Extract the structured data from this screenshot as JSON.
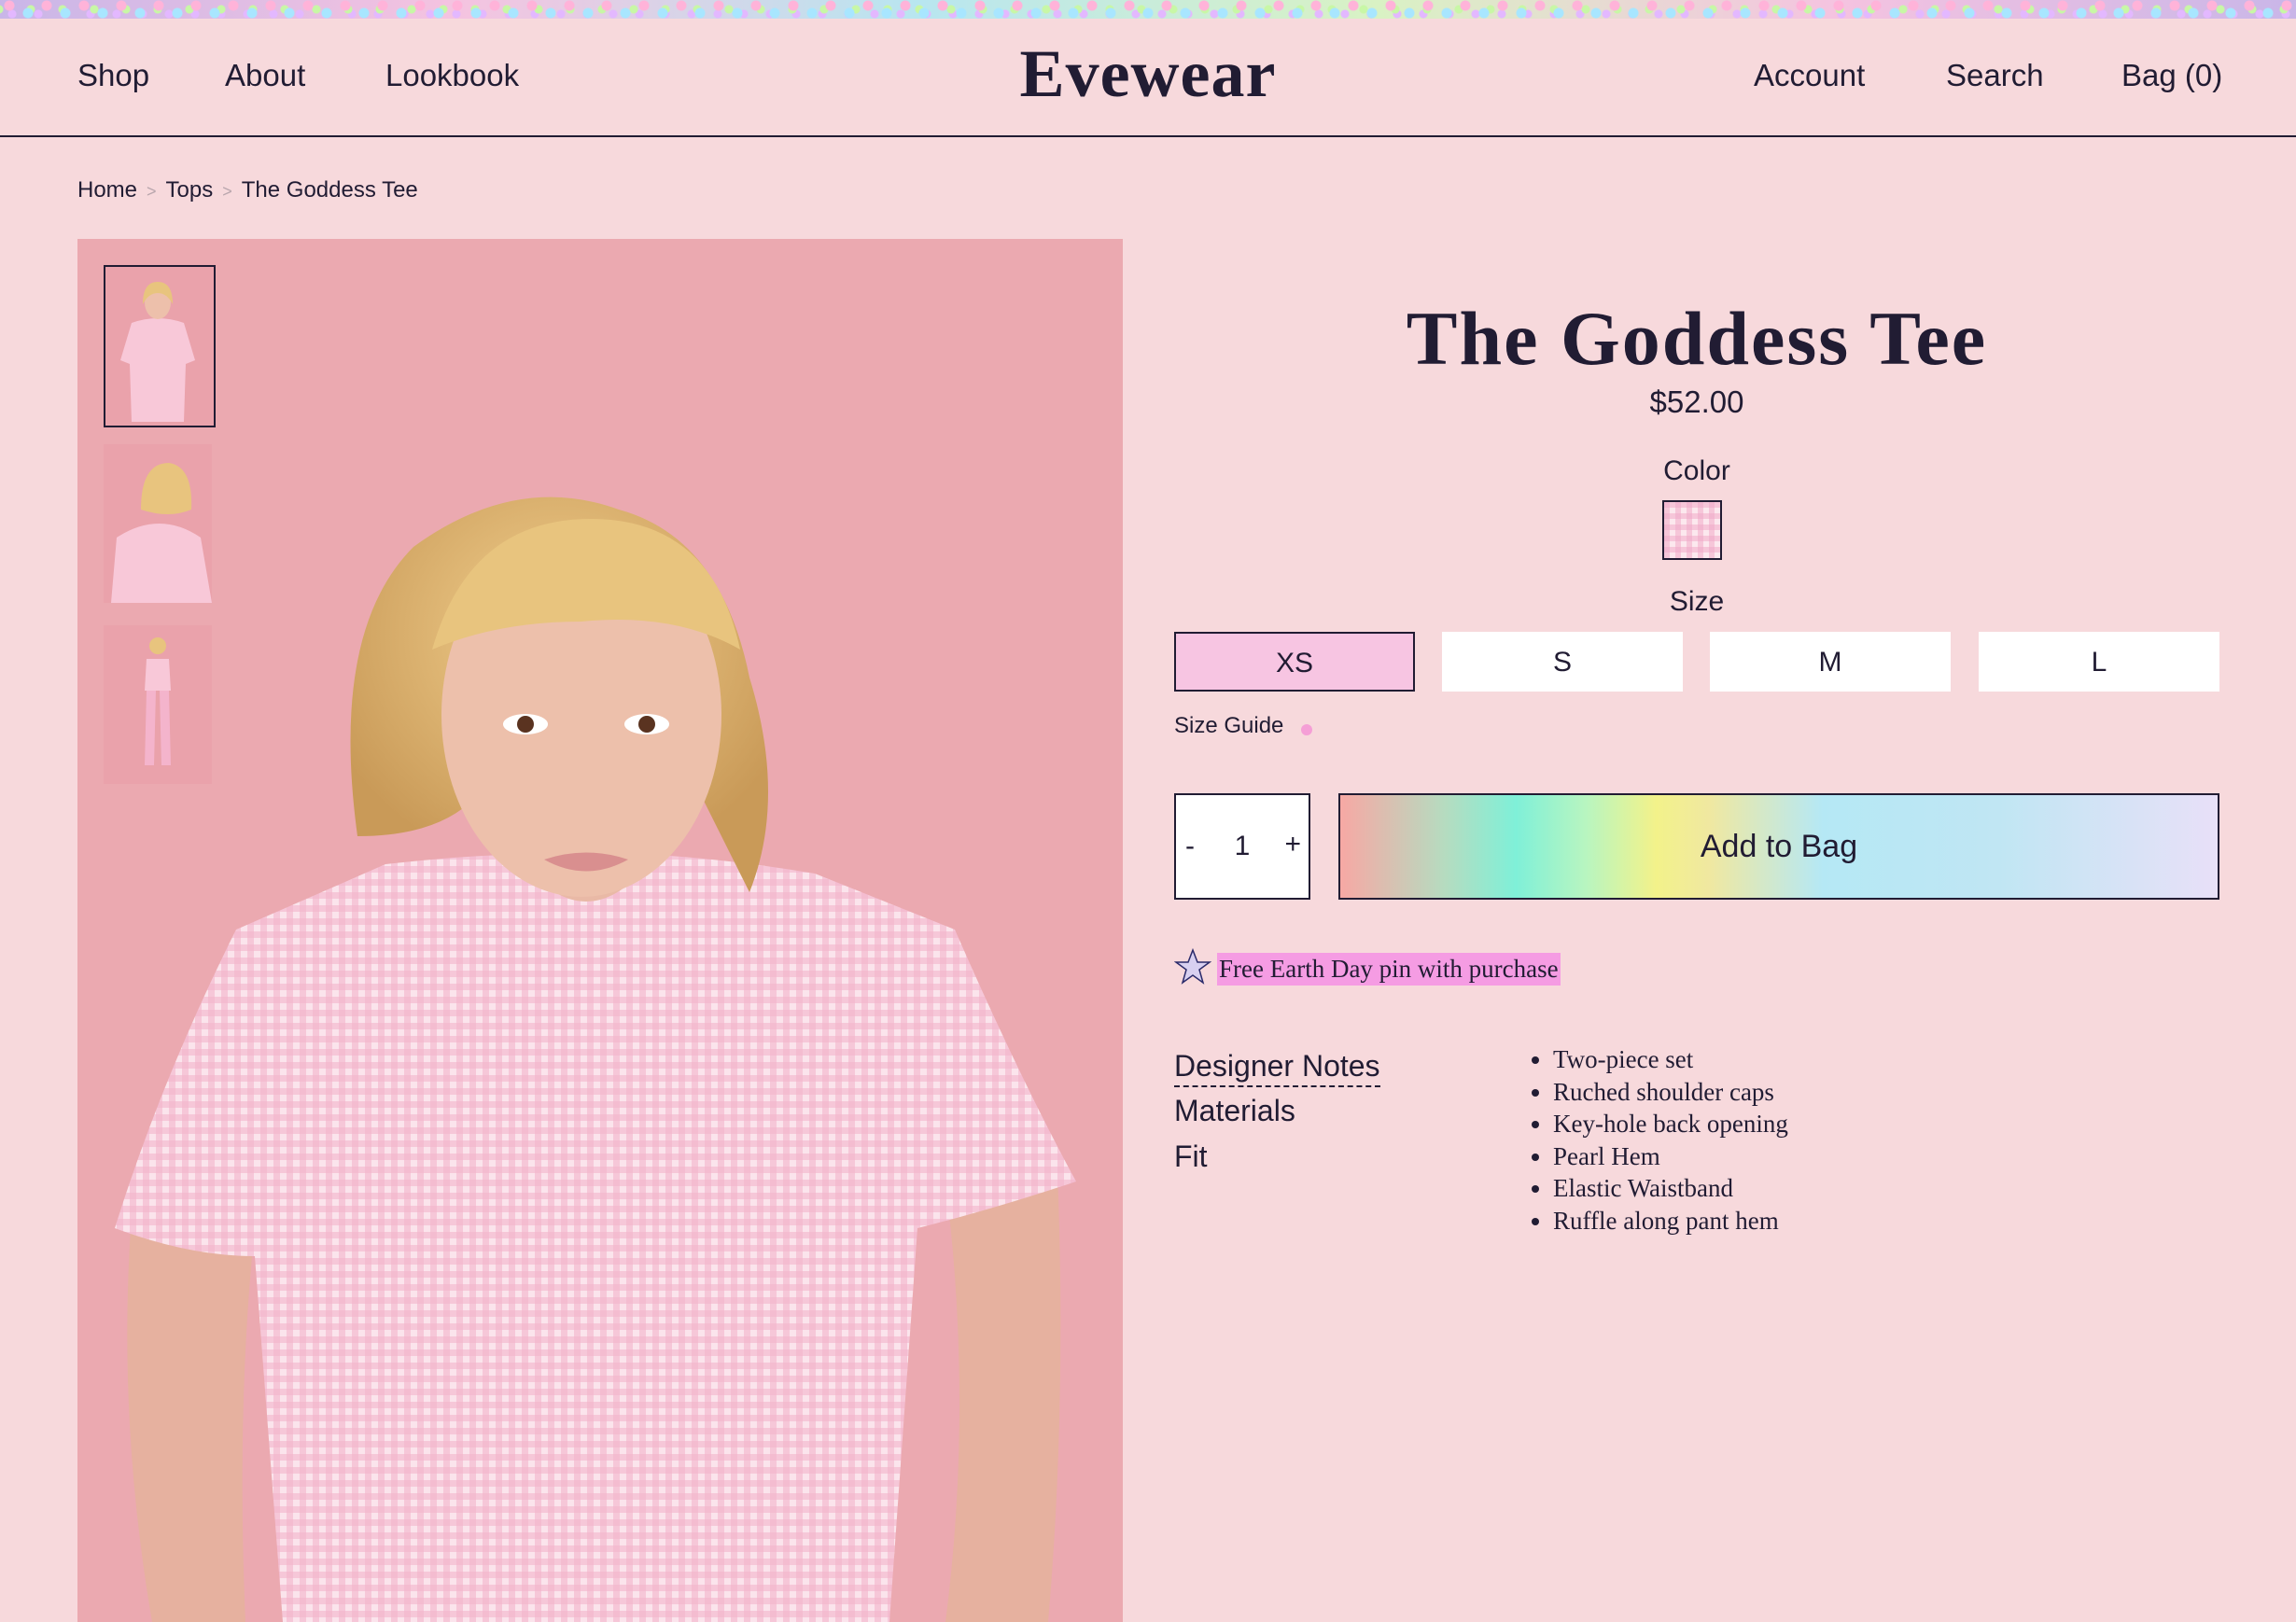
{
  "nav": {
    "left": [
      "Shop",
      "About",
      "Lookbook"
    ],
    "logo": "Evewear",
    "right": [
      "Account",
      "Search",
      "Bag (0)"
    ]
  },
  "breadcrumb": [
    "Home",
    "Tops",
    "The Goddess Tee"
  ],
  "breadcrumb_separator": ">",
  "product": {
    "title": "The Goddess Tee",
    "price": "$52.00",
    "color_label": "Color",
    "size_label": "Size",
    "sizes": [
      "XS",
      "S",
      "M",
      "L"
    ],
    "selected_size": "XS",
    "size_guide": "Size Guide",
    "quantity": "1",
    "qty_minus": "-",
    "qty_plus": "+",
    "add_to_bag": "Add to Bag",
    "promo": "Free Earth Day pin with purchase",
    "tabs": [
      "Designer Notes",
      "Materials",
      "Fit"
    ],
    "active_tab": "Designer Notes",
    "designer_notes": [
      "Two-piece set",
      "Ruched shoulder caps",
      "Key-hole back opening",
      "Pearl Hem",
      "Elastic Waistband",
      "Ruffle along pant hem"
    ]
  },
  "colors": {
    "background": "#f7d9dc",
    "text": "#211c33",
    "photo_background": "#eba9b0",
    "selected_size": "#f7c5e2",
    "promo_highlight": "#f59ce3"
  }
}
